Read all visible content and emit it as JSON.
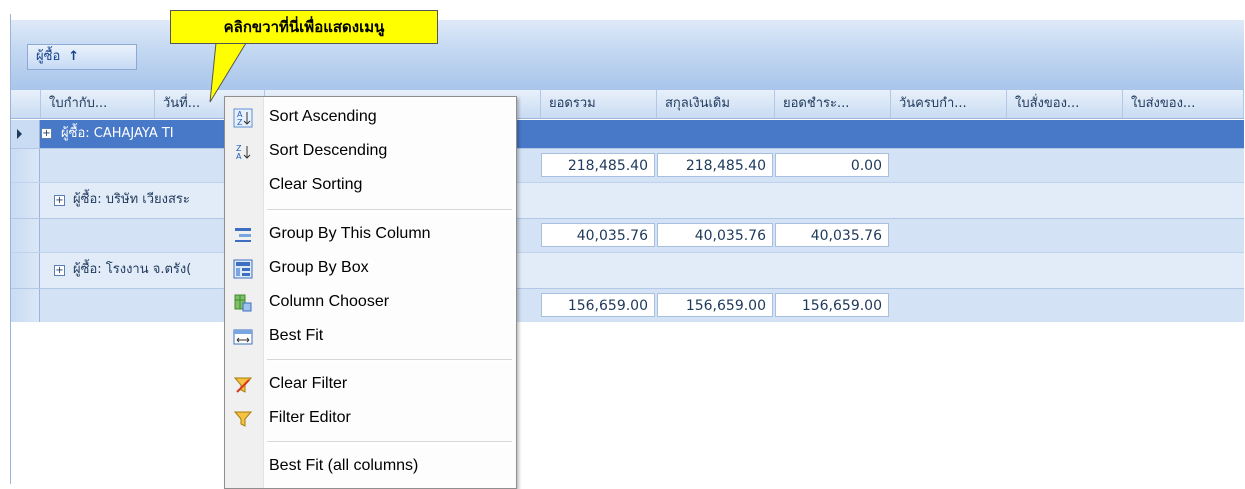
{
  "callout": {
    "text": "คลิกขวาที่นี่เพื่อแสดงเมนู"
  },
  "group_panel": {
    "chip_label": "ผู้ซื้อ",
    "sort_arrow": "↑"
  },
  "columns": [
    "ใบกำกับ...",
    "วันที่...",
    "ยอดรวม",
    "สกุลเงินเดิม",
    "ยอดชำระ...",
    "วันครบกำ...",
    "ใบสั่งของ...",
    "ใบส่งของ..."
  ],
  "groups": [
    {
      "label": "ผู้ซื้อ: CAHAJAYA TI",
      "totals": [
        "218,485.40",
        "218,485.40",
        "0.00"
      ]
    },
    {
      "label": "ผู้ซื้อ: บริษัท เวียงสระ",
      "totals": [
        "40,035.76",
        "40,035.76",
        "40,035.76"
      ]
    },
    {
      "label": "ผู้ซื้อ: โรงงาน จ.ตรัง(",
      "totals": [
        "156,659.00",
        "156,659.00",
        "156,659.00"
      ]
    }
  ],
  "context_menu": {
    "items": [
      {
        "label": "Sort Ascending",
        "icon": "sort-ascending-icon"
      },
      {
        "label": "Sort Descending",
        "icon": "sort-descending-icon"
      },
      {
        "label": "Clear Sorting",
        "icon": ""
      },
      {
        "label": "Group By This Column",
        "icon": "group-by-column-icon"
      },
      {
        "label": "Group By Box",
        "icon": "group-by-box-icon"
      },
      {
        "label": "Column Chooser",
        "icon": "column-chooser-icon"
      },
      {
        "label": "Best Fit",
        "icon": "best-fit-icon"
      },
      {
        "label": "Clear Filter",
        "icon": "clear-filter-icon"
      },
      {
        "label": "Filter Editor",
        "icon": "filter-editor-icon"
      },
      {
        "label": "Best Fit (all columns)",
        "icon": ""
      }
    ]
  },
  "colors": {
    "selected_row": "#4878c8",
    "header_blue": "#c9dcf3",
    "callout": "#ffff00"
  }
}
